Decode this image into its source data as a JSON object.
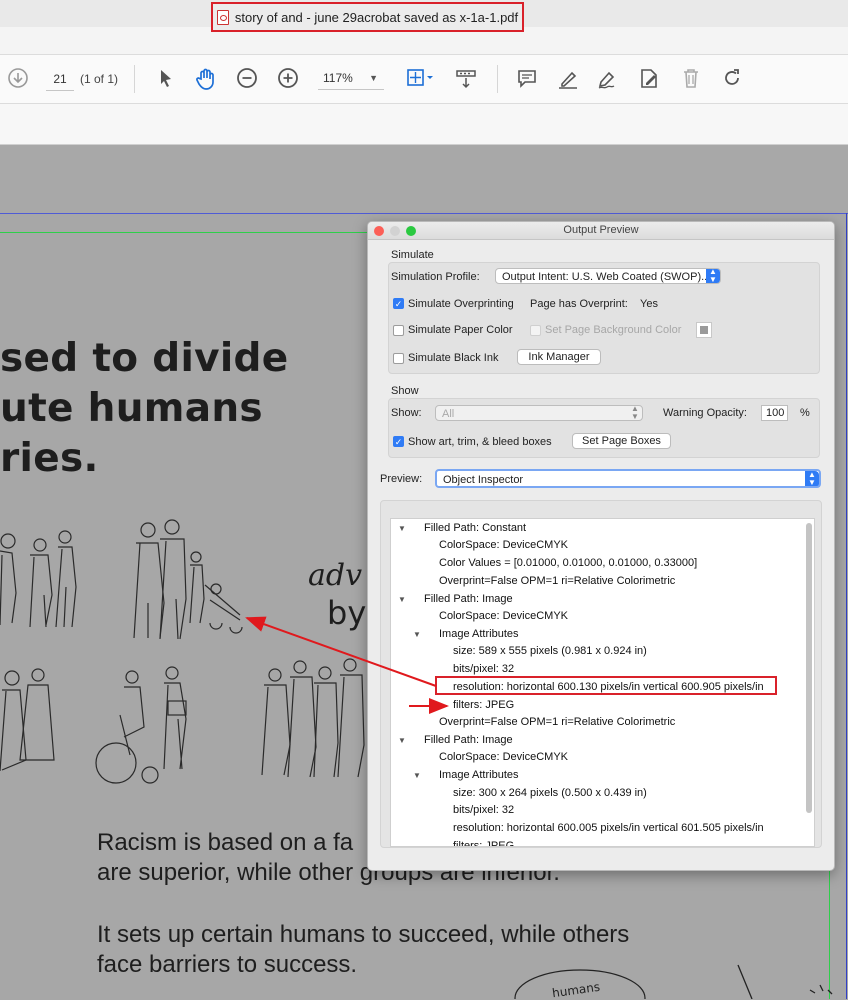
{
  "window": {
    "title": "story of and - june 29acrobat saved as x-1a-1.pdf"
  },
  "toolbar": {
    "page_number": "21",
    "page_count": "(1 of 1)",
    "zoom": "117%"
  },
  "document": {
    "headline": "sed to divide\nute humans\nries.",
    "adv": "adv",
    "by": "by",
    "body1": "Racism is based on a fa\nare superior, while other groups are inferior.",
    "body2": "It sets up certain humans to succeed, while others\nface barriers to success.",
    "sketch_word": "humans"
  },
  "panel": {
    "title": "Output Preview",
    "simulate_section": "Simulate",
    "simulation_profile_label": "Simulation Profile:",
    "simulation_profile_value": "Output Intent: U.S. Web Coated (SWOP)...",
    "simulate_overprinting": "Simulate Overprinting",
    "page_has_overprint_label": "Page has Overprint:",
    "page_has_overprint_value": "Yes",
    "simulate_paper_color": "Simulate Paper Color",
    "set_page_background_color": "Set Page Background Color",
    "simulate_black_ink": "Simulate Black Ink",
    "ink_manager": "Ink Manager",
    "show_section": "Show",
    "show_label": "Show:",
    "show_value": "All",
    "warning_opacity_label": "Warning Opacity:",
    "warning_opacity_value": "100",
    "percent": "%",
    "show_boxes": "Show art, trim, & bleed boxes",
    "set_page_boxes": "Set Page Boxes",
    "preview_label": "Preview:",
    "preview_value": "Object Inspector",
    "tree": [
      "Filled Path: Constant",
      "ColorSpace: DeviceCMYK",
      "Color Values = [0.01000, 0.01000, 0.01000, 0.33000]",
      "Overprint=False OPM=1 ri=Relative Colorimetric",
      "Filled Path: Image",
      "ColorSpace: DeviceCMYK",
      "Image Attributes",
      "size: 589 x 555 pixels (0.981 x 0.924 in)",
      "bits/pixel: 32",
      "resolution: horizontal 600.130 pixels/in vertical 600.905 pixels/in",
      "filters: JPEG",
      "Overprint=False OPM=1 ri=Relative Colorimetric",
      "Filled Path: Image",
      "ColorSpace: DeviceCMYK",
      "Image Attributes",
      "size: 300 x 264 pixels (0.500 x 0.439 in)",
      "bits/pixel: 32",
      "resolution: horizontal 600.005 pixels/in vertical 601.505 pixels/in",
      "filters: JPEG"
    ]
  },
  "colors": {
    "accent": "#2f7bf5",
    "annotation": "#d9212a"
  }
}
